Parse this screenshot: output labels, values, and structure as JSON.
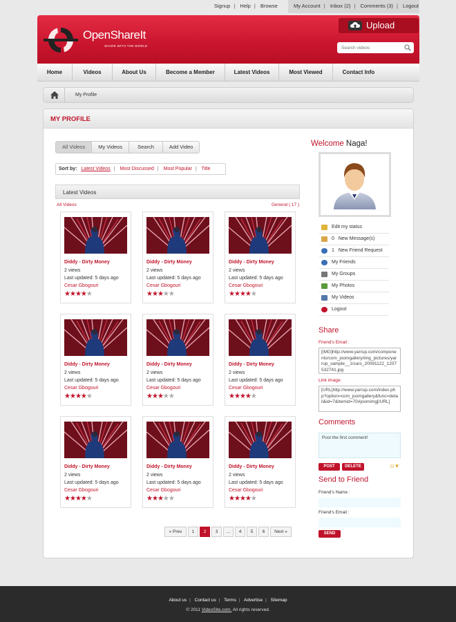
{
  "top_links": {
    "left": [
      "Signup",
      "Help",
      "Browse"
    ],
    "right": [
      "My Account",
      "Inbox (2)",
      "Comments (3)",
      "Logout"
    ]
  },
  "header": {
    "brand": "OpenShareIt",
    "tagline": "SHARE WITH THE WORLD",
    "upload_label": "Upload",
    "search_placeholder": "Search videos",
    "brand_color": "#c9152e"
  },
  "nav": [
    "Home",
    "Videos",
    "About Us",
    "Become a Member",
    "Latest Videos",
    "Most Viewed",
    "Contact Info"
  ],
  "breadcrumb": {
    "current": "My Profile"
  },
  "page_title": "MY PROFILE",
  "tabs": [
    "All Videos",
    "My Videos",
    "Search",
    "Add Video"
  ],
  "sort": {
    "label": "Sort by:",
    "options": [
      "Latest Videos",
      "Most Discussed",
      "Most Popular",
      "Title"
    ],
    "selected": "Latest Videos"
  },
  "videos_section": {
    "heading": "Latest Videos",
    "all_link": "All Videos",
    "category": "General ( 17 )"
  },
  "videos": [
    {
      "title": "Diddy - Dirty Money",
      "views": "2 views",
      "updated": "Last updated: 5 days ago",
      "author": "Cesar Gbogouri",
      "rating": 4
    },
    {
      "title": "Diddy - Dirty Money",
      "views": "2 views",
      "updated": "Last updated: 5 days ago",
      "author": "Cesar Gbogouri",
      "rating": 3
    },
    {
      "title": "Diddy - Dirty Money",
      "views": "2 views",
      "updated": "Last updated: 5 days ago",
      "author": "Cesar Gbogouri",
      "rating": 4
    },
    {
      "title": "Diddy - Dirty Money",
      "views": "2 views",
      "updated": "Last updated: 5 days ago",
      "author": "Cesar Gbogouri",
      "rating": 4
    },
    {
      "title": "Diddy - Dirty Money",
      "views": "2 views",
      "updated": "Last updated: 5 days ago",
      "author": "Cesar Gbogouri",
      "rating": 3
    },
    {
      "title": "Diddy - Dirty Money",
      "views": "2 views",
      "updated": "Last updated: 5 days ago",
      "author": "Cesar Gbogouri",
      "rating": 4
    },
    {
      "title": "Diddy - Dirty Money",
      "views": "2 views",
      "updated": "Last updated: 5 days ago",
      "author": "Cesar Gbogouri",
      "rating": 4
    },
    {
      "title": "Diddy - Dirty Money",
      "views": "2 views",
      "updated": "Last updated: 5 days ago",
      "author": "Cesar Gbogouri",
      "rating": 3
    },
    {
      "title": "Diddy - Dirty Money",
      "views": "2 views",
      "updated": "Last updated: 5 days ago",
      "author": "Cesar Gbogouri",
      "rating": 4
    }
  ],
  "pagination": {
    "prev": "« Prev",
    "pages": [
      "1",
      "2",
      "3",
      "...",
      "4",
      "5",
      "6"
    ],
    "current": "2",
    "next": "Next »"
  },
  "sidebar": {
    "welcome": "Welcome",
    "user_name": "Naga!",
    "menu": [
      {
        "label": "Edit my status",
        "icon": "pencil-icon",
        "color": "#e0b53a"
      },
      {
        "label": "0   New Message(s)",
        "icon": "message-icon",
        "color": "#d9a64a"
      },
      {
        "label": "1   New Friend Request",
        "icon": "friend-request-icon",
        "color": "#3b6fb6"
      },
      {
        "label": "My Friends",
        "icon": "friends-icon",
        "color": "#3b6fb6"
      },
      {
        "label": "My Groups",
        "icon": "groups-icon",
        "color": "#777777"
      },
      {
        "label": "My Photos",
        "icon": "photos-icon",
        "color": "#5a9a3a"
      },
      {
        "label": "My Videos",
        "icon": "videos-icon",
        "color": "#5577aa"
      },
      {
        "label": "Logout",
        "icon": "power-icon",
        "color": "#c0132b"
      }
    ],
    "share": {
      "heading": "Share",
      "friends_email_label": "Friend's Email :",
      "img_code": "[IMG]http://www.yarrup.com/components/com_joomgallery/img_pictures/yarrup_sample__1/cars_20091122_1207532741.jpg",
      "link_label": "Link image:",
      "link_code": "[URL]http://www.yarrup.com/index.php?option=com_joomgallery&func=detail&id=7&Itemid=70#joomimg[/URL]"
    },
    "comments": {
      "heading": "Comments",
      "placeholder": "Post the first comment!",
      "post_label": "POST",
      "delete_label": "DELETE"
    },
    "send_friend": {
      "heading": "Send to Friend",
      "name_label": "Friend's Name :",
      "email_label": "Friend's Email :",
      "send_label": "SEND"
    }
  },
  "footer": {
    "links": [
      "About us",
      "Contact us",
      "Terms",
      "Advertise",
      "Sitemap"
    ],
    "copyright_prefix": "© 2011 ",
    "copyright_site": "VideoSite.com.",
    "copyright_suffix": " All rights reserved."
  }
}
